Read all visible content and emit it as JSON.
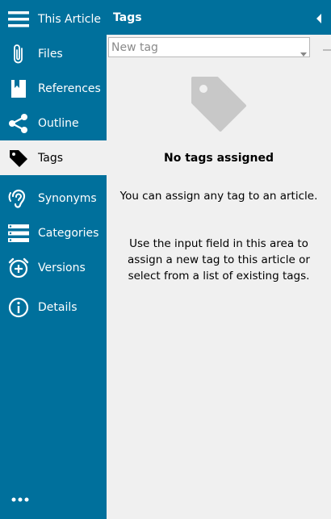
{
  "sidebar": {
    "items": [
      {
        "label": "This Article",
        "icon": "menu-icon",
        "active": false
      },
      {
        "label": "Files",
        "icon": "paperclip-icon",
        "active": false
      },
      {
        "label": "References",
        "icon": "bookmark-icon",
        "active": false
      },
      {
        "label": "Outline",
        "icon": "share-icon",
        "active": false
      },
      {
        "label": "Tags",
        "icon": "tag-icon",
        "active": true
      },
      {
        "label": "Synonyms",
        "icon": "ear-icon",
        "active": false
      },
      {
        "label": "Categories",
        "icon": "list-icon",
        "active": false
      },
      {
        "label": "Versions",
        "icon": "alarm-plus-icon",
        "active": false
      },
      {
        "label": "Details",
        "icon": "info-icon",
        "active": false
      }
    ],
    "more_icon": "more-dots-icon"
  },
  "panel": {
    "title": "Tags",
    "collapse_icon": "chevron-left-icon"
  },
  "tag_input": {
    "placeholder": "New tag",
    "value": ""
  },
  "empty_state": {
    "icon": "tag-icon",
    "title": "No tags assigned",
    "text1": "You can assign any tag to an article.",
    "text2": "Use the input field in this area to assign a new tag to this article or select from a list of existing tags."
  },
  "colors": {
    "sidebar_bg": "#00709c",
    "active_bg": "#f0f0f0",
    "empty_icon": "#c8c8c8"
  }
}
